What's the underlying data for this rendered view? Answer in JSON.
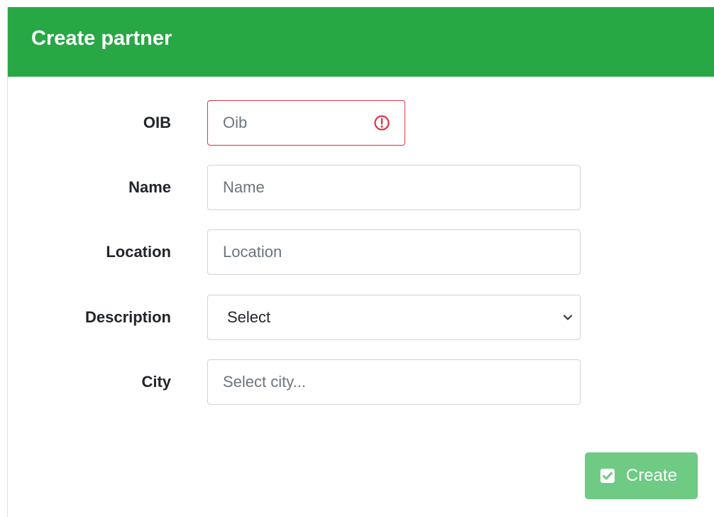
{
  "card": {
    "title": "Create partner",
    "header_color": "#28a745"
  },
  "form": {
    "oib": {
      "label": "OIB",
      "placeholder": "Oib",
      "value": "",
      "state": "invalid",
      "icon": "exclamation-circle-icon"
    },
    "name": {
      "label": "Name",
      "placeholder": "Name",
      "value": ""
    },
    "location": {
      "label": "Location",
      "placeholder": "Location",
      "value": ""
    },
    "description": {
      "label": "Description",
      "selected": "Select",
      "icon": "chevron-down-icon"
    },
    "city": {
      "label": "City",
      "placeholder": "Select city...",
      "value": ""
    }
  },
  "actions": {
    "create_label": "Create",
    "create_icon": "check-square-icon",
    "create_color": "#6fca84",
    "create_disabled": true
  },
  "colors": {
    "invalid": "#dc3545",
    "border": "#ced4da"
  }
}
